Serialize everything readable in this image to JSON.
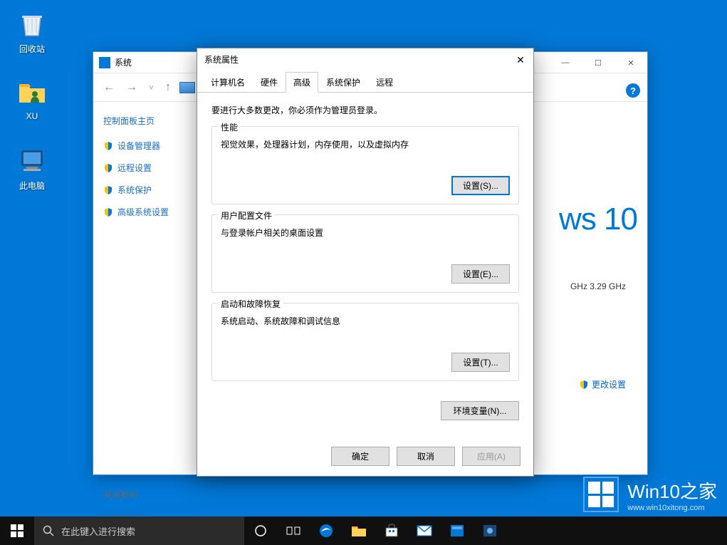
{
  "desktop": {
    "icons": [
      {
        "label": "回收站"
      },
      {
        "label": "XU"
      },
      {
        "label": "此电脑"
      }
    ]
  },
  "system_window": {
    "title": "系统",
    "minimize": "—",
    "maximize": "☐",
    "close": "✕",
    "sidebar": {
      "heading": "控制面板主页",
      "links": [
        "设备管理器",
        "远程设置",
        "系统保护",
        "高级系统设置"
      ],
      "see_also_label": "另请参阅",
      "see_also_link": "安全和维护"
    },
    "win10_text": "ws 10",
    "cpu_info": "GHz   3.29 GHz",
    "change_settings": "更改设置",
    "help": "?"
  },
  "props": {
    "title": "系统属性",
    "close": "✕",
    "tabs": [
      "计算机名",
      "硬件",
      "高级",
      "系统保护",
      "远程"
    ],
    "active_tab": 2,
    "note": "要进行大多数更改，你必须作为管理员登录。",
    "group_perf": {
      "label": "性能",
      "desc": "视觉效果，处理器计划，内存使用，以及虚拟内存",
      "btn": "设置(S)..."
    },
    "group_profile": {
      "label": "用户配置文件",
      "desc": "与登录帐户相关的桌面设置",
      "btn": "设置(E)..."
    },
    "group_startup": {
      "label": "启动和故障恢复",
      "desc": "系统启动、系统故障和调试信息",
      "btn": "设置(T)..."
    },
    "env_btn": "环境变量(N)...",
    "ok": "确定",
    "cancel": "取消",
    "apply": "应用(A)"
  },
  "taskbar": {
    "search_placeholder": "在此键入进行搜索"
  },
  "watermark": {
    "line1_a": "Win10",
    "line1_b": "之家",
    "line2": "www.win10xitong.com"
  }
}
